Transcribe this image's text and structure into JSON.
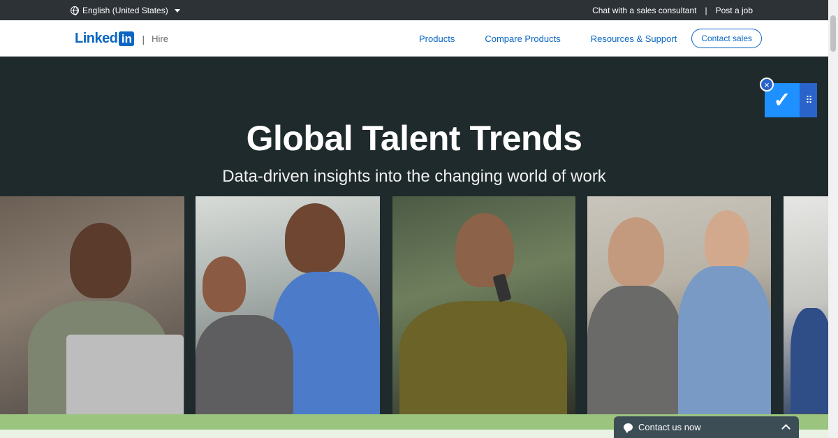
{
  "topbar": {
    "language": "English (United States)",
    "chat_link": "Chat with a sales consultant",
    "separator": "|",
    "post_job_link": "Post a job"
  },
  "header": {
    "logo_text": "Linked",
    "logo_box": "in",
    "divider": "|",
    "product_name": "Hire",
    "nav": [
      "Products",
      "Compare Products",
      "Resources & Support"
    ],
    "contact_sales": "Contact sales"
  },
  "hero": {
    "title": "Global Talent Trends",
    "subtitle": "Data-driven insights into the changing world of work"
  },
  "widget": {
    "check_glyph": "✓",
    "grip_glyph": "⠿",
    "close_glyph": "×"
  },
  "contact_bar": {
    "label": "Contact us now"
  },
  "colors": {
    "brand_blue": "#0a66c2",
    "hero_bg": "#1f2a2c",
    "green_band": "#9bc47e"
  }
}
